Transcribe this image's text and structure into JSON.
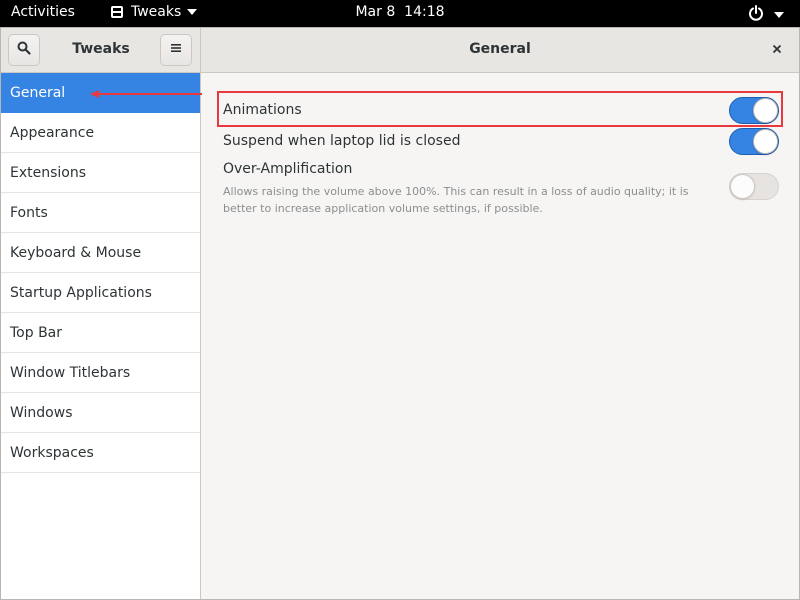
{
  "topbar": {
    "activities": "Activities",
    "app_name": "Tweaks",
    "clock_date": "Mar 8",
    "clock_time": "14:18"
  },
  "header": {
    "sidebar_title": "Tweaks",
    "page_title": "General"
  },
  "sidebar": {
    "items": [
      {
        "label": "General",
        "selected": true
      },
      {
        "label": "Appearance"
      },
      {
        "label": "Extensions"
      },
      {
        "label": "Fonts"
      },
      {
        "label": "Keyboard & Mouse"
      },
      {
        "label": "Startup Applications"
      },
      {
        "label": "Top Bar"
      },
      {
        "label": "Window Titlebars"
      },
      {
        "label": "Windows"
      },
      {
        "label": "Workspaces"
      }
    ]
  },
  "settings": {
    "animations": {
      "label": "Animations",
      "enabled": true
    },
    "suspend": {
      "label": "Suspend when laptop lid is closed",
      "enabled": true
    },
    "over_amplification": {
      "label": "Over-Amplification",
      "description": "Allows raising the volume above 100%. This can result in a loss of audio quality; it is better to increase application volume settings, if possible.",
      "enabled": false
    }
  },
  "colors": {
    "accent": "#3584e4",
    "annotation": "#e8393f",
    "topbar": "#000000"
  },
  "icons": [
    "app-menu-icon",
    "power-icon",
    "search-icon",
    "hamburger-menu-icon",
    "close-icon"
  ]
}
